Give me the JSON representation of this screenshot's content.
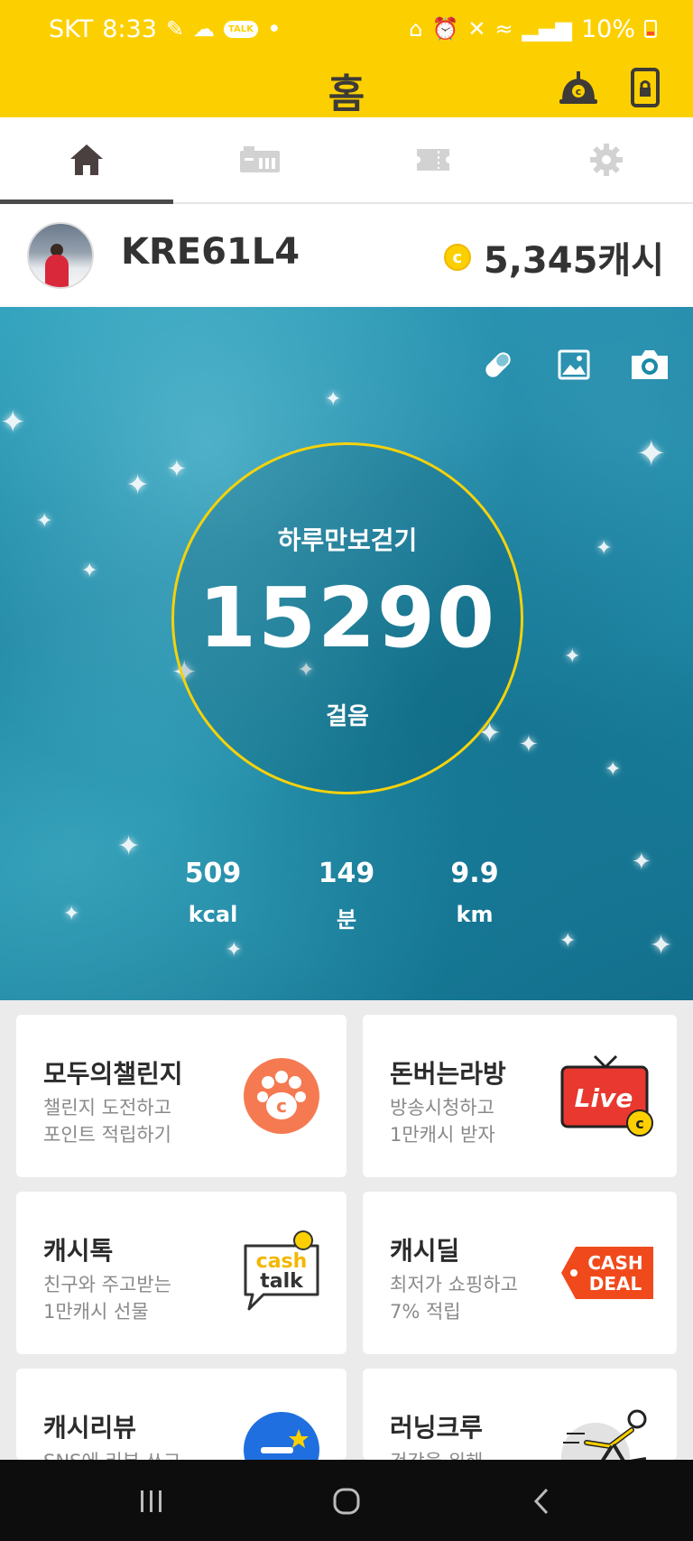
{
  "status_bar": {
    "carrier": "SKT",
    "time": "8:33",
    "talk_badge": "TALK",
    "battery": "10%"
  },
  "header": {
    "title": "홈"
  },
  "tabs": [
    {
      "name": "home",
      "icon": "home-icon",
      "active": true
    },
    {
      "name": "store",
      "icon": "store-icon",
      "active": false
    },
    {
      "name": "ticket",
      "icon": "ticket-icon",
      "active": false
    },
    {
      "name": "settings",
      "icon": "gear-icon",
      "active": false
    }
  ],
  "profile": {
    "username": "KRE61L4",
    "coin_symbol": "c",
    "cash": "5,345캐시"
  },
  "pedometer": {
    "label": "하루만보걷기",
    "steps": "15290",
    "steps_unit": "걸음",
    "stats": [
      {
        "value": "509",
        "unit": "kcal"
      },
      {
        "value": "149",
        "unit": "분"
      },
      {
        "value": "9.9",
        "unit": "km"
      }
    ]
  },
  "cards": [
    {
      "title": "모두의챌린지",
      "line1": "챌린지 도전하고",
      "line2": "포인트 적립하기",
      "icon": "challenge-paw-icon"
    },
    {
      "title": "돈버는라방",
      "line1": "방송시청하고",
      "line2": "1만캐시 받자",
      "icon": "live-tv-icon",
      "badge": "Live"
    },
    {
      "title": "캐시톡",
      "line1": "친구와 주고받는",
      "line2": "1만캐시 선물",
      "icon": "cash-talk-icon",
      "badge1": "cash",
      "badge2": "talk"
    },
    {
      "title": "캐시딜",
      "line1": "최저가 쇼핑하고",
      "line2": "7% 적립",
      "icon": "cash-deal-icon",
      "badge1": "CASH",
      "badge2": "DEAL"
    },
    {
      "title": "캐시리뷰",
      "line1": "SNS에 리뷰 쓰고",
      "line2": "",
      "icon": "review-icon"
    },
    {
      "title": "러닝크루",
      "line1": "건강을 위해",
      "line2": "",
      "icon": "running-icon"
    }
  ],
  "colors": {
    "brand_yellow": "#fcd000",
    "accent_orange": "#f57a52",
    "live_red": "#e8382f"
  }
}
